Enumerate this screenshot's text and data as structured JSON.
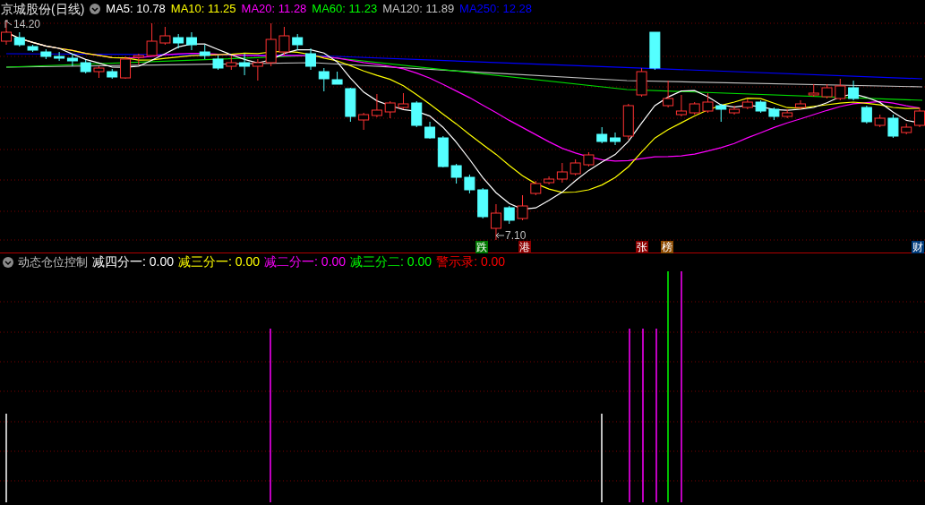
{
  "main_chart": {
    "title": "京城股份(日线)",
    "moving_averages": [
      {
        "label": "MA5:",
        "value": "10.78",
        "color": "#ffffff"
      },
      {
        "label": "MA10:",
        "value": "11.25",
        "color": "#ffff00"
      },
      {
        "label": "MA20:",
        "value": "11.28",
        "color": "#ff00ff"
      },
      {
        "label": "MA60:",
        "value": "11.23",
        "color": "#00ff00"
      },
      {
        "label": "MA120:",
        "value": "11.89",
        "color": "#c0c0c0"
      },
      {
        "label": "MA250:",
        "value": "12.28",
        "color": "#0000ff"
      }
    ],
    "high_label": "14.20",
    "low_label": "7.10",
    "event_markers": [
      {
        "text": "跌",
        "color": "#007800"
      },
      {
        "text": "港",
        "color": "#8c0000"
      },
      {
        "text": "张",
        "color": "#8c0000"
      },
      {
        "text": "榜",
        "color": "#8c4a00"
      },
      {
        "text": "财",
        "color": "#003a7a"
      }
    ]
  },
  "indicator": {
    "name": "动态仓位控制",
    "items": [
      {
        "label": "减四分一:",
        "value": "0.00",
        "color": "#ffffff"
      },
      {
        "label": "减三分一:",
        "value": "0.00",
        "color": "#ffff00"
      },
      {
        "label": "减二分一:",
        "value": "0.00",
        "color": "#ff00ff"
      },
      {
        "label": "减三分二:",
        "value": "0.00",
        "color": "#00ff00"
      },
      {
        "label": "警示录:",
        "value": "0.00",
        "color": "#ff0000"
      }
    ]
  }
}
